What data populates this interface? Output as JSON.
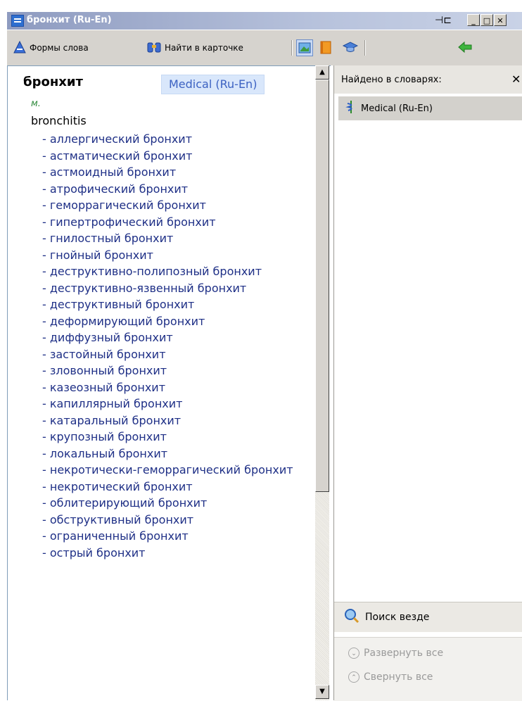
{
  "window": {
    "title": "бронхит (Ru-En)"
  },
  "toolbar": {
    "word_forms_label": "Формы слова",
    "find_in_card_label": "Найти в карточке"
  },
  "article": {
    "headword": "бронхит",
    "dictionary_badge": "Medical (Ru-En)",
    "gram_label": "м.",
    "translation": "bronchitis",
    "phrases": [
      "- аллергический бронхит",
      "- астматический бронхит",
      "- астмоидный бронхит",
      "- атрофический бронхит",
      "- геморрагический бронхит",
      "- гипертрофический бронхит",
      "- гнилостный бронхит",
      "- гнойный бронхит",
      "- деструктивно-полипозный бронхит",
      "- деструктивно-язвенный бронхит",
      "- деструктивный бронхит",
      "- деформирующий бронхит",
      "- диффузный бронхит",
      "- застойный бронхит",
      "- зловонный бронхит",
      "- казеозный бронхит",
      "- капиллярный бронхит",
      "- катаральный бронхит",
      "- крупозный бронхит",
      "- локальный бронхит",
      "- некротически-геморрагический бронхит",
      "- некротический бронхит",
      "- облитерирующий бронхит",
      "- обструктивный бронхит",
      "- ограниченный бронхит",
      "- острый бронхит"
    ]
  },
  "found_panel": {
    "title": "Найдено в словарях:",
    "dictionaries": [
      "Medical (Ru-En)"
    ],
    "search_everywhere": "Поиск везде",
    "expand_all": "Развернуть все",
    "collapse_all": "Свернуть все"
  },
  "colors": {
    "link_blue": "#1e2f86",
    "gram_green": "#2f8a3c",
    "badge_bg": "#d9e7fb",
    "badge_text": "#3c62c2"
  }
}
